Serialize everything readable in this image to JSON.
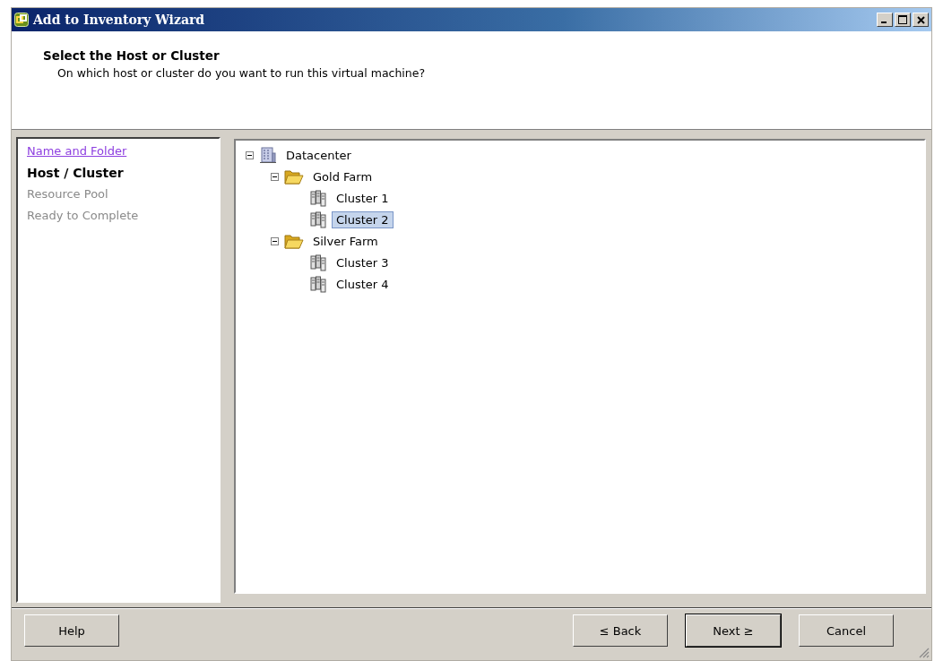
{
  "window": {
    "title": "Add to Inventory Wizard"
  },
  "header": {
    "title": "Select the Host or Cluster",
    "subtitle": "On which host or cluster do you want to run this virtual machine?"
  },
  "steps": [
    {
      "label": "Name and Folder",
      "kind": "done"
    },
    {
      "label": "Host / Cluster",
      "kind": "current"
    },
    {
      "label": "Resource Pool",
      "kind": "pending"
    },
    {
      "label": "Ready to Complete",
      "kind": "pending"
    }
  ],
  "tree": [
    {
      "label": "Datacenter",
      "kind": "datacenter",
      "expanded": true,
      "selected": false,
      "children": [
        {
          "label": "Gold Farm",
          "kind": "folder",
          "expanded": true,
          "selected": false,
          "children": [
            {
              "label": "Cluster 1",
              "kind": "cluster",
              "selected": false
            },
            {
              "label": "Cluster 2",
              "kind": "cluster",
              "selected": true
            }
          ]
        },
        {
          "label": "Silver Farm",
          "kind": "folder",
          "expanded": true,
          "selected": false,
          "children": [
            {
              "label": "Cluster 3",
              "kind": "cluster",
              "selected": false
            },
            {
              "label": "Cluster 4",
              "kind": "cluster",
              "selected": false
            }
          ]
        }
      ]
    }
  ],
  "buttons": {
    "help": "Help",
    "back": "≤ Back",
    "next": "Next ≥",
    "cancel": "Cancel"
  }
}
